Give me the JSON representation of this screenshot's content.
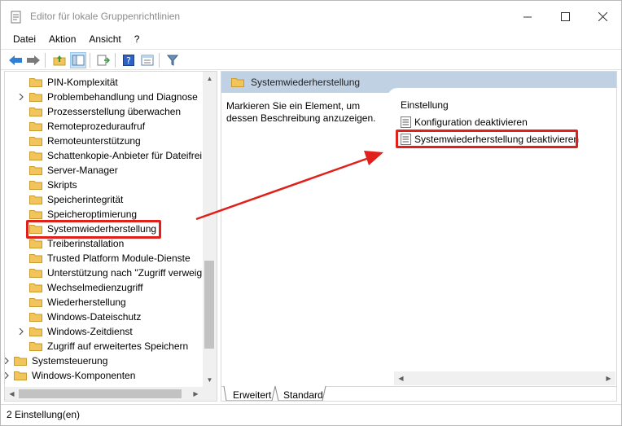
{
  "window": {
    "title": "Editor für lokale Gruppenrichtlinien"
  },
  "menu": [
    "Datei",
    "Aktion",
    "Ansicht",
    "?"
  ],
  "toolbar": {
    "icons": [
      "back-arrow-icon",
      "forward-arrow-icon",
      "up-folder-icon",
      "show-hide-tree-icon",
      "export-list-icon",
      "help-icon",
      "extended-view-icon",
      "filter-icon"
    ]
  },
  "tree": {
    "items": [
      {
        "label": "PIN-Komplexität",
        "expandable": false
      },
      {
        "label": "Problembehandlung und Diagnose",
        "expandable": true
      },
      {
        "label": "Prozesserstellung überwachen",
        "expandable": false
      },
      {
        "label": "Remoteprozeduraufruf",
        "expandable": false
      },
      {
        "label": "Remoteunterstützung",
        "expandable": false
      },
      {
        "label": "Schattenkopie-Anbieter für Dateifrei",
        "expandable": false
      },
      {
        "label": "Server-Manager",
        "expandable": false
      },
      {
        "label": "Skripts",
        "expandable": false
      },
      {
        "label": "Speicherintegrität",
        "expandable": false
      },
      {
        "label": "Speicheroptimierung",
        "expandable": false
      },
      {
        "label": "Systemwiederherstellung",
        "expandable": false,
        "selected": true
      },
      {
        "label": "Treiberinstallation",
        "expandable": false
      },
      {
        "label": "Trusted Platform Module-Dienste",
        "expandable": false
      },
      {
        "label": "Unterstützung nach \"Zugriff verweig",
        "expandable": false
      },
      {
        "label": "Wechselmedienzugriff",
        "expandable": false
      },
      {
        "label": "Wiederherstellung",
        "expandable": false
      },
      {
        "label": "Windows-Dateischutz",
        "expandable": false
      },
      {
        "label": "Windows-Zeitdienst",
        "expandable": true
      },
      {
        "label": "Zugriff auf erweitertes Speichern",
        "expandable": false
      }
    ],
    "top_items": [
      {
        "label": "Systemsteuerung",
        "expandable": true
      },
      {
        "label": "Windows-Komponenten",
        "expandable": true
      }
    ]
  },
  "right": {
    "header": "Systemwiederherstellung",
    "description": "Markieren Sie ein Element, um dessen Beschreibung anzuzeigen.",
    "column_header": "Einstellung",
    "settings": [
      {
        "label": "Konfiguration deaktivieren"
      },
      {
        "label": "Systemwiederherstellung deaktivieren",
        "highlighted": true
      }
    ],
    "tabs": [
      "Erweitert",
      "Standard"
    ]
  },
  "status": {
    "text": "2 Einstellung(en)"
  },
  "colors": {
    "accent_highlight": "#e0201b",
    "header_bg": "#c0d1e4",
    "folder": "#f1c55b"
  }
}
